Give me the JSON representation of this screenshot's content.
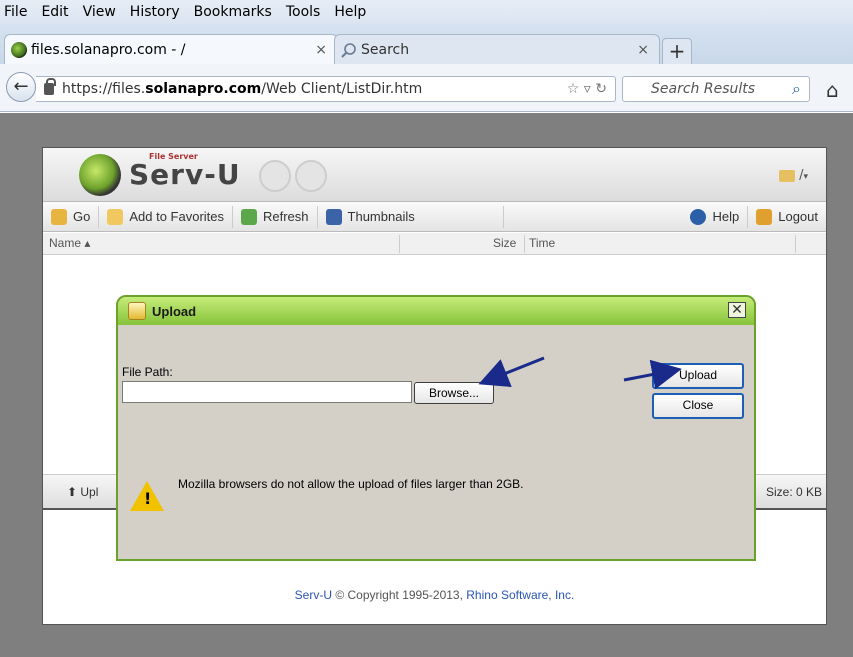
{
  "menubar": {
    "items": [
      "File",
      "Edit",
      "View",
      "History",
      "Bookmarks",
      "Tools",
      "Help"
    ],
    "accesskeys": [
      "F",
      "E",
      "V",
      "s",
      "B",
      "T",
      "H"
    ]
  },
  "tabs": [
    {
      "title": "files.solanapro.com - /",
      "close": "×"
    },
    {
      "title": "Search",
      "close": "×"
    }
  ],
  "newtab": "+",
  "url": {
    "prefix": "https://files.",
    "host": "solanapro.com",
    "path": "/Web Client/ListDir.htm"
  },
  "searchbar": {
    "placeholder": "Search Results"
  },
  "app": {
    "logo_main": "Serv-U",
    "logo_sub": "File Server",
    "current_path": "/",
    "toolbar": {
      "go": "Go",
      "favorites": "Add to Favorites",
      "refresh": "Refresh",
      "thumbnails": "Thumbnails",
      "help": "Help",
      "logout": "Logout"
    },
    "columns": {
      "name": "Name",
      "size": "Size",
      "time": "Time"
    },
    "status": {
      "upload": "Upl",
      "size": "Size: 0 KB"
    },
    "footer": {
      "product": "Serv-U",
      "copyright": " © Copyright 1995-2013, ",
      "company": "Rhino Software, Inc."
    }
  },
  "dialog": {
    "title": "Upload",
    "close_glyph": "✕",
    "file_path_label": "File Path:",
    "file_path_value": "",
    "browse_label": "Browse...",
    "upload_label": "Upload",
    "close_label": "Close",
    "warning": "Mozilla browsers do not allow the upload of files larger than 2GB."
  },
  "colors": {
    "dialog_title": "#86c33a",
    "annotation_arrow": "#1a2a8a",
    "link": "#2a56b5"
  }
}
